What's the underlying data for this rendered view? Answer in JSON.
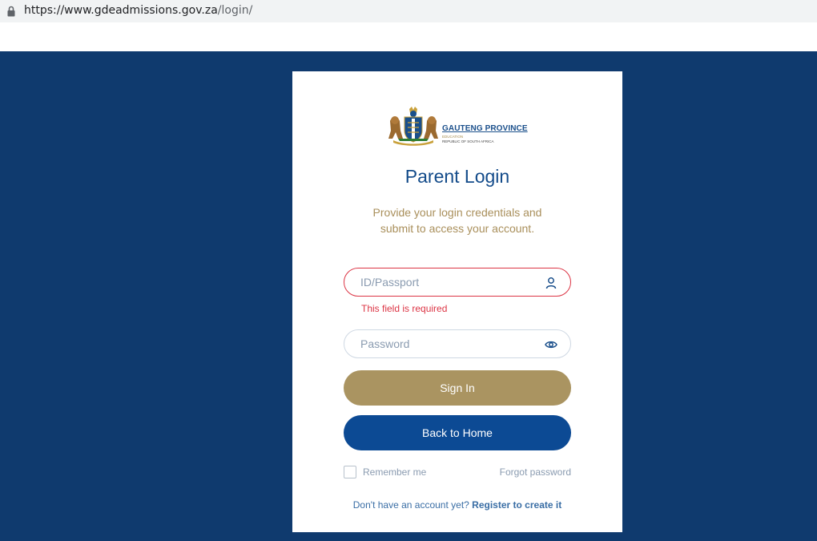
{
  "browser": {
    "url_host": "https://www.gdeadmissions.gov.za",
    "url_path": "/login/"
  },
  "logo": {
    "name": "GAUTENG PROVINCE",
    "department": "EDUCATION",
    "country": "REPUBLIC OF SOUTH AFRICA"
  },
  "login": {
    "title": "Parent Login",
    "subtitle": "Provide your login credentials and submit to access your account.",
    "id_placeholder": "ID/Passport",
    "id_error": "This field is required",
    "password_placeholder": "Password",
    "signin_label": "Sign In",
    "home_label": "Back to Home",
    "remember_label": "Remember me",
    "forgot_label": "Forgot password",
    "no_account_text": "Don't have an account yet?",
    "register_label": "Register to create it"
  },
  "icons": {
    "lock": "lock-icon",
    "user": "user-icon",
    "eye": "eye-icon",
    "crest": "coat-of-arms-logo"
  },
  "colors": {
    "background": "#0f3a6e",
    "title": "#134b8a",
    "subtitle": "#a98f5b",
    "error": "#dc3545",
    "signin": "#aa9461",
    "home": "#0c4a94",
    "link": "#3a6ea5"
  }
}
